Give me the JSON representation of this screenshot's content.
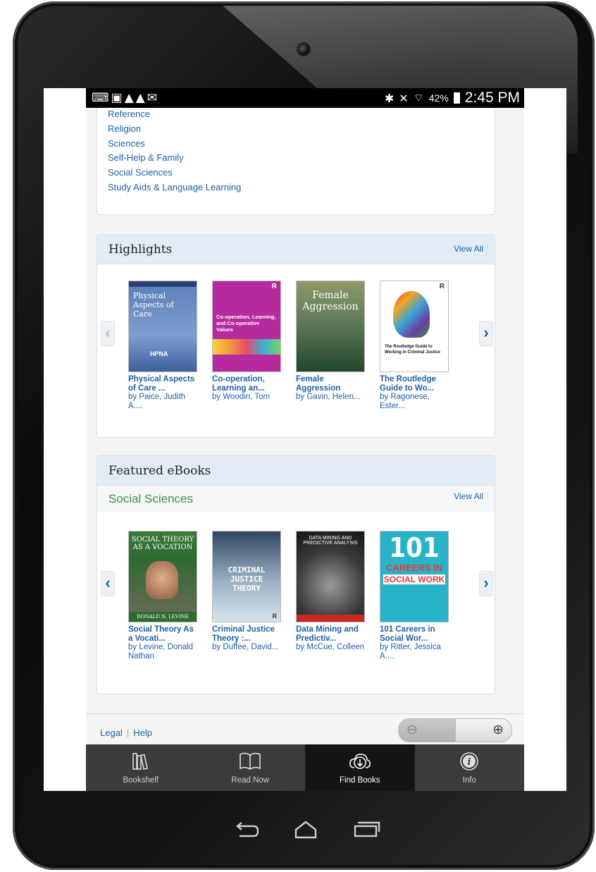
{
  "status_bar": {
    "left_icons": "⌨▣▲▲✉",
    "battery": "42%",
    "time": "2:45 PM"
  },
  "categories": [
    "Reference",
    "Religion",
    "Sciences",
    "Self-Help & Family",
    "Social Sciences",
    "Study Aids & Language Learning"
  ],
  "highlights": {
    "title": "Highlights",
    "view_all": "View All",
    "books": [
      {
        "title": "Physical Aspects of Care ...",
        "by": "by",
        "author": "Paice, Judith A...."
      },
      {
        "title": "Co-operation, Learning an...",
        "by": "by",
        "author": "Woodin, Tom"
      },
      {
        "title": "Female Aggression",
        "by": "by",
        "author": "Gavin, Helen..."
      },
      {
        "title": "The Routledge Guide to Wo...",
        "by": "by",
        "author": "Ragonese, Ester..."
      }
    ],
    "covers": [
      {
        "line1": "Physical",
        "line2": "Aspects of Care",
        "logo": "HPNA"
      },
      {
        "line1": "Co-operation, Learning,",
        "line2": "and Co-operative Values",
        "logo": "R"
      },
      {
        "line1": "Female",
        "line2": "Aggression"
      },
      {
        "line1": "The Routledge Guide to",
        "line2": "Working in Criminal Justice",
        "logo": "R"
      }
    ]
  },
  "featured": {
    "title": "Featured eBooks",
    "subtitle": "Social Sciences",
    "view_all": "View All",
    "books": [
      {
        "title": "Social Theory As a Vocati...",
        "by": "by",
        "author": "Levine, Donald Nathan"
      },
      {
        "title": "Criminal Justice Theory :...",
        "by": "by",
        "author": "Duffee, David..."
      },
      {
        "title": "Data Mining and Predictiv...",
        "by": "by",
        "author": "McCue, Colleen"
      },
      {
        "title": "101 Careers in Social Wor...",
        "by": "by",
        "author": "Ritter, Jessica A...."
      }
    ],
    "covers": [
      {
        "line1": "SOCIAL THEORY",
        "line2": "AS A VOCATION",
        "logo": "DONALD N. LEVINE"
      },
      {
        "line1": "CRIMINAL",
        "line2": "JUSTICE",
        "line3": "THEORY",
        "logo": "R"
      },
      {
        "line1": "DATA MINING AND",
        "line2": "PREDICTIVE ANALYSIS"
      },
      {
        "line1": "101",
        "line2": "CAREERS IN",
        "line3": "SOCIAL WORK"
      }
    ]
  },
  "footer": {
    "legal": "Legal",
    "sep": "|",
    "help": "Help",
    "zoom_out": "⊖",
    "zoom_in": "⊕"
  },
  "tabs": [
    {
      "label": "Bookshelf",
      "icon": "bookshelf-icon"
    },
    {
      "label": "Read Now",
      "icon": "open-book-icon"
    },
    {
      "label": "Find Books",
      "icon": "download-icon",
      "active": true
    },
    {
      "label": "Info",
      "icon": "info-icon"
    }
  ],
  "nav_arrows": {
    "left_disabled": "‹",
    "left": "‹",
    "right": "›"
  },
  "colors": {
    "link": "#1f5fa5",
    "accent_green": "#3e8f4a",
    "panel_header": "#e3ecf5",
    "tabbar": "#3b3b3b",
    "tab_active": "#141414"
  }
}
